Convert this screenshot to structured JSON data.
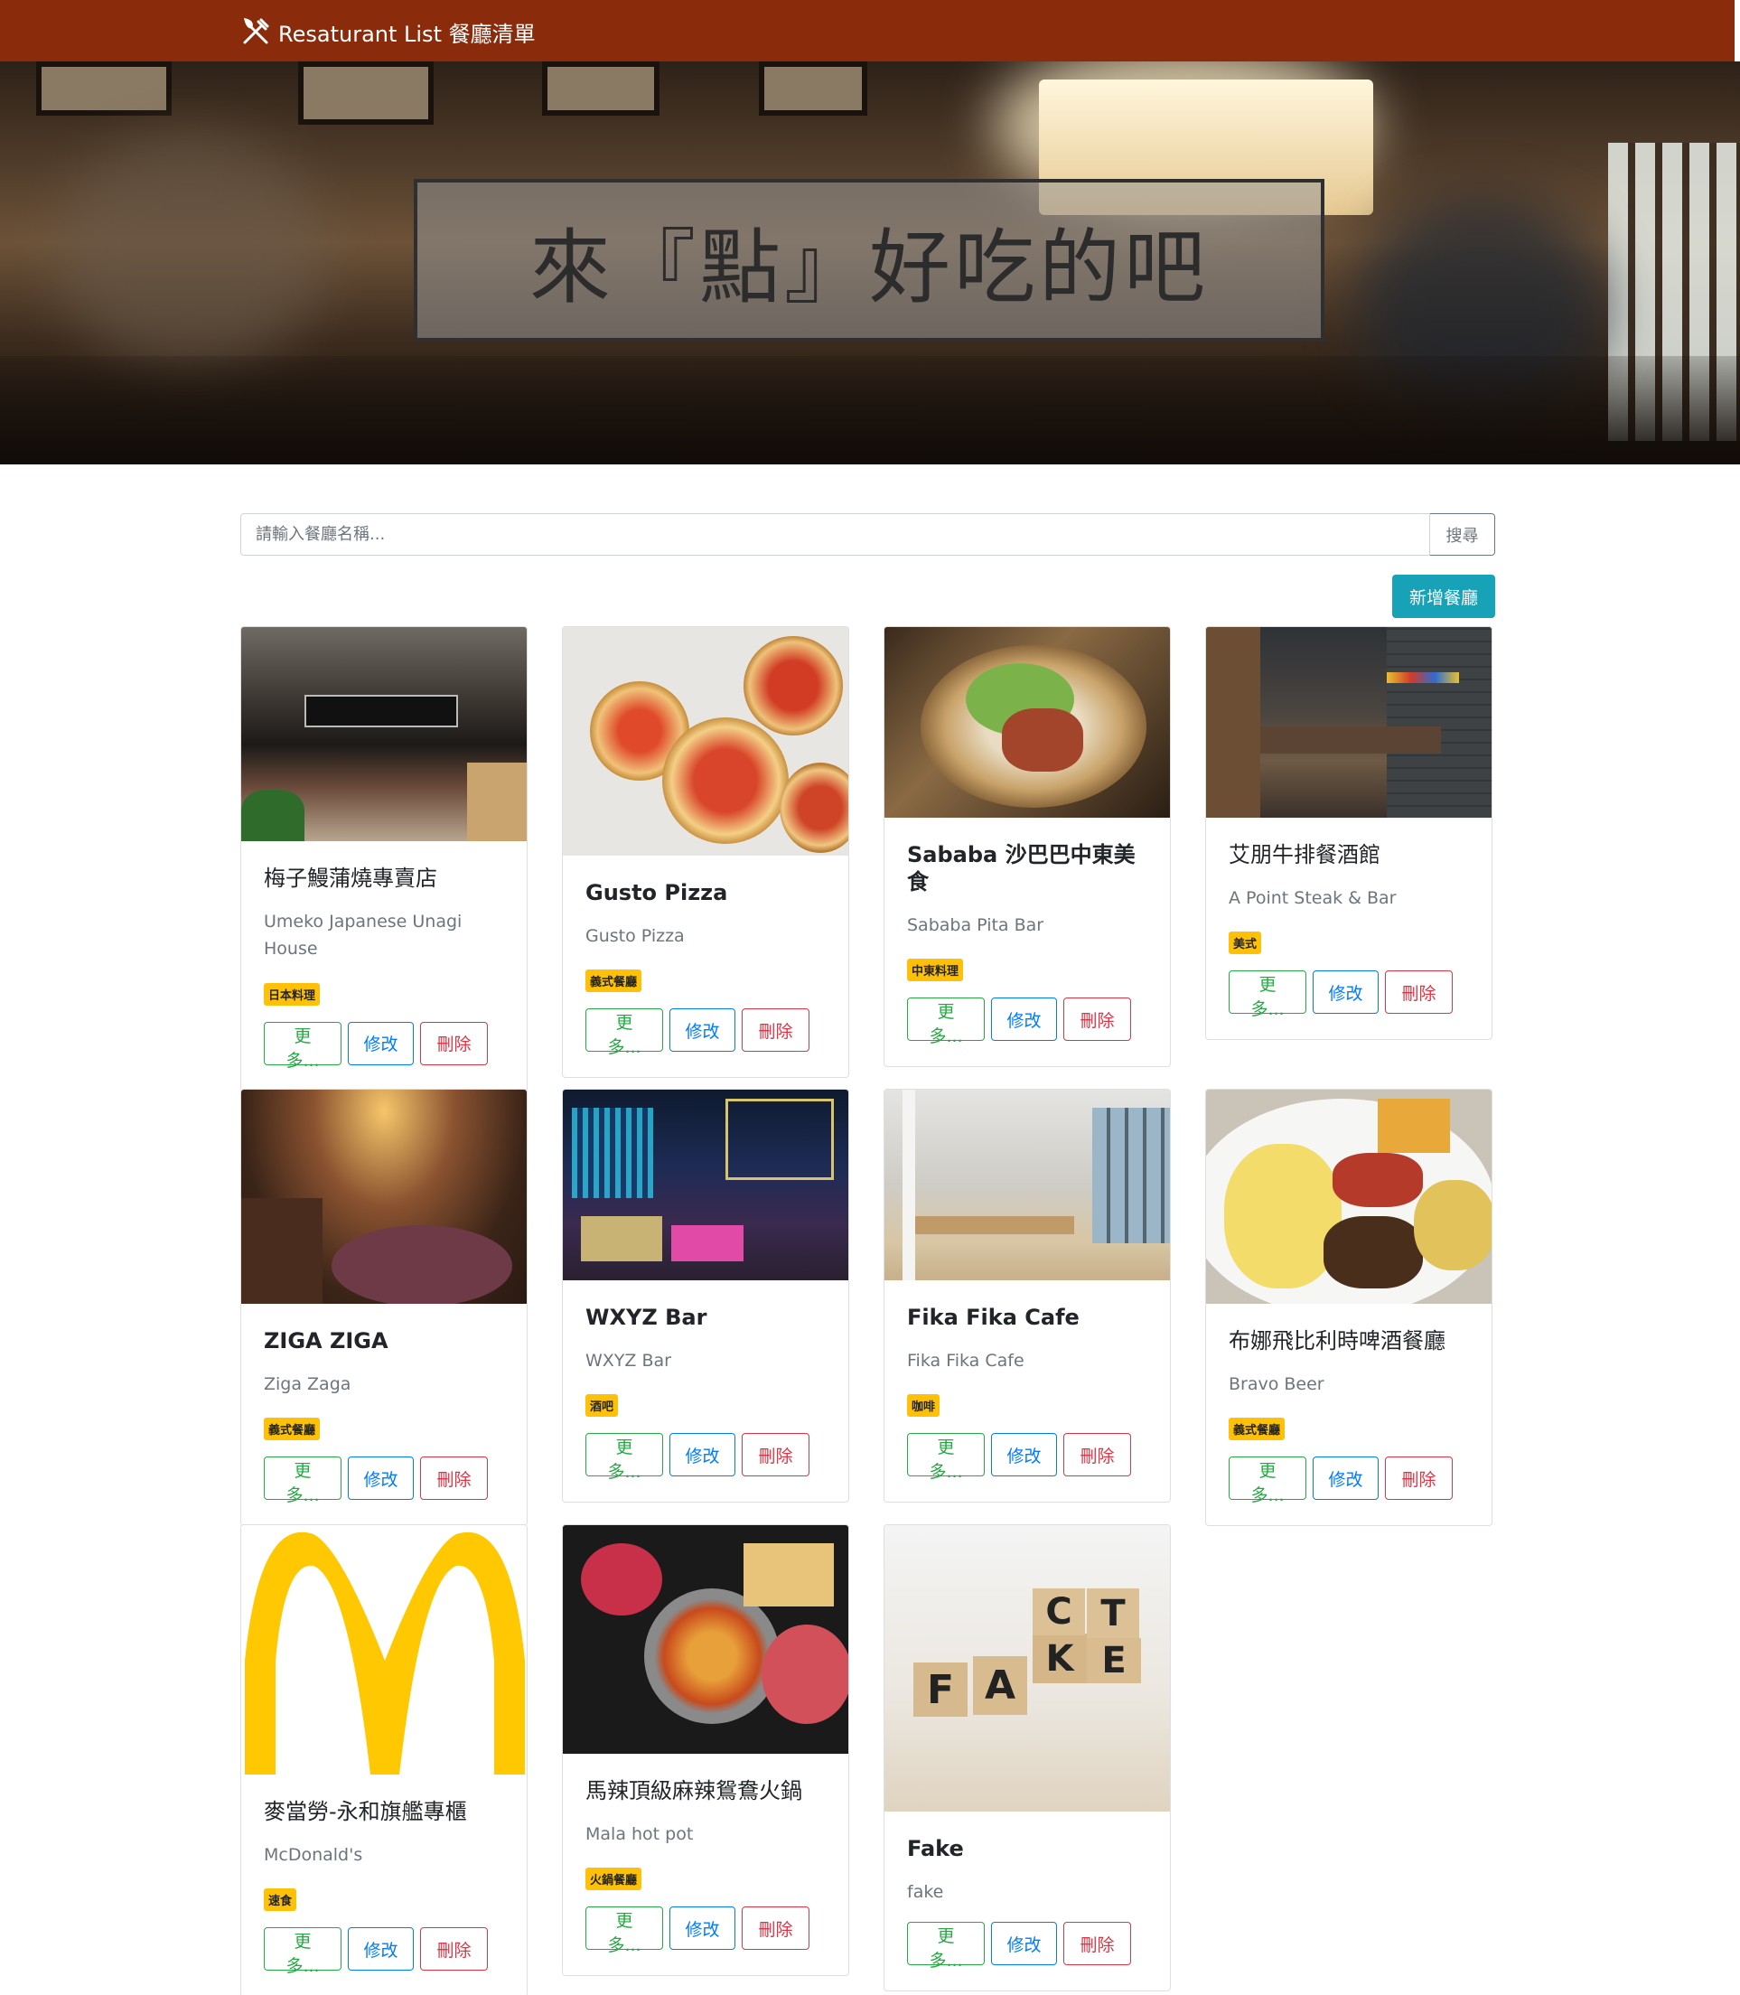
{
  "navbar": {
    "brand": "Resaturant List 餐廳清單",
    "icon": "fork-knife-icon"
  },
  "banner": {
    "title": "來『點』好吃的吧"
  },
  "search": {
    "placeholder": "請輸入餐廳名稱...",
    "button": "搜尋"
  },
  "add_button": "新增餐廳",
  "button_labels": {
    "more": "更多...",
    "edit": "修改",
    "delete": "刪除"
  },
  "restaurants": [
    {
      "name": "梅子鰻蒲燒專賣店",
      "name_en": "Umeko Japanese Unagi House",
      "category": "日本料理"
    },
    {
      "name": "Gusto Pizza",
      "name_en": "Gusto Pizza",
      "category": "義式餐廳"
    },
    {
      "name": "Sababa 沙巴巴中東美食",
      "name_en": "Sababa Pita Bar",
      "category": "中東料理"
    },
    {
      "name": "艾朋牛排餐酒館",
      "name_en": "A Point Steak & Bar",
      "category": "美式"
    },
    {
      "name": "ZIGA ZIGA",
      "name_en": "Ziga Zaga",
      "category": "義式餐廳"
    },
    {
      "name": "WXYZ Bar",
      "name_en": "WXYZ Bar",
      "category": "酒吧"
    },
    {
      "name": "Fika Fika Cafe",
      "name_en": "Fika Fika Cafe",
      "category": "咖啡"
    },
    {
      "name": "布娜飛比利時啤酒餐廳",
      "name_en": "Bravo Beer",
      "category": "義式餐廳"
    },
    {
      "name": "麥當勞-永和旗艦專櫃",
      "name_en": "McDonald's",
      "category": "速食"
    },
    {
      "name": "馬辣頂級麻辣鴛鴦火鍋",
      "name_en": "Mala hot pot",
      "category": "火鍋餐廳"
    },
    {
      "name": "Fake",
      "name_en": "fake",
      "category": ""
    }
  ],
  "colors": {
    "navbar": "#8a2b0b",
    "accent": "#17a2b8",
    "badge": "#ffc107",
    "more": "#28a745",
    "edit": "#007bff",
    "delete": "#dc3545"
  }
}
